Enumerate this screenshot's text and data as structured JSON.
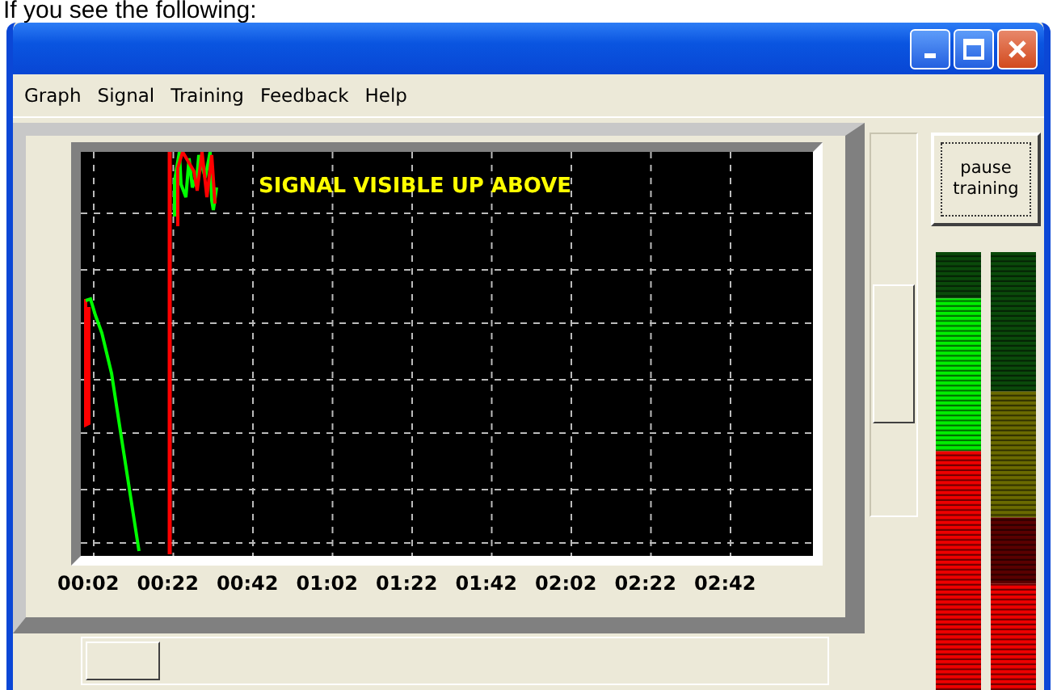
{
  "page_text": "If you see the following:",
  "window": {
    "controls": [
      {
        "kind": "minimize"
      },
      {
        "kind": "maximize"
      },
      {
        "kind": "close"
      }
    ]
  },
  "menu": [
    "Graph",
    "Signal",
    "Training",
    "Feedback",
    "Help"
  ],
  "graph": {
    "overlay_text": "SIGNAL VISIBLE UP ABOVE",
    "x_labels": [
      "00:02",
      "00:22",
      "00:42",
      "01:02",
      "01:22",
      "01:42",
      "02:02",
      "02:22",
      "02:42"
    ]
  },
  "slider": {
    "level": 0.38
  },
  "pause_button": "pause training"
}
